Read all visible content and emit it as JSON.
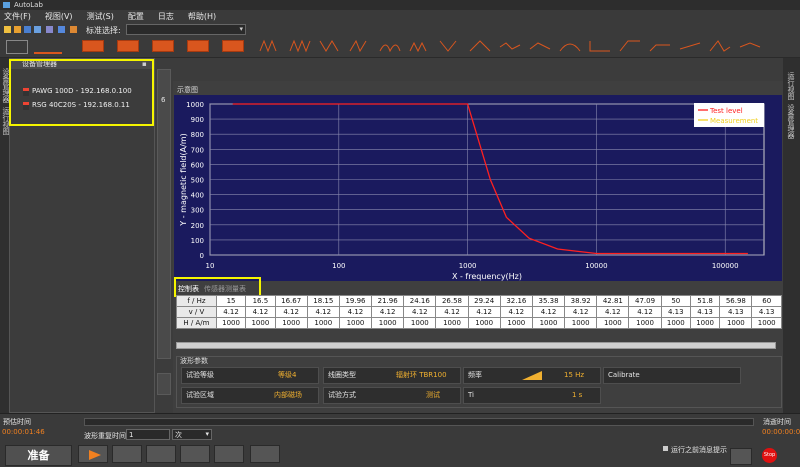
{
  "window": {
    "title": "AutoLab"
  },
  "menu": [
    "文件(F)",
    "视图(V)",
    "测试(S)",
    "配置",
    "日志",
    "帮助(H)"
  ],
  "toolbar": {
    "standard_select_label": "标准选择:",
    "standard_select_value": ""
  },
  "left_tabs": [
    "设备管理器",
    "运行视图"
  ],
  "right_tabs": [
    "运行视图",
    "设备管理器"
  ],
  "device_manager": {
    "title": "设备管理器",
    "devices": [
      "PAWG 100D - 192.168.0.100",
      "RSG 40C20S - 192.168.0.11"
    ]
  },
  "mid_tab_number": "6",
  "schematic_label": "示意图",
  "chart_data": {
    "type": "line",
    "xscale": "log",
    "xlim": [
      10,
      200000
    ],
    "ylim": [
      0,
      1000
    ],
    "xlabel": "X - frequency(Hz)",
    "ylabel": "Y - magnetic field(A/m)",
    "xticks": [
      "10",
      "100",
      "1000",
      "10000",
      "100000"
    ],
    "yticks": [
      "0",
      "100",
      "200",
      "300",
      "400",
      "500",
      "600",
      "700",
      "800",
      "900",
      "1000"
    ],
    "legend_position": "top-right",
    "series": [
      {
        "name": "Test level",
        "color": "#ff2020",
        "x": [
          15,
          1000,
          1500,
          2000,
          3000,
          5000,
          10000,
          50000,
          150000
        ],
        "y": [
          1000,
          1000,
          500,
          250,
          111,
          40,
          10,
          10,
          10
        ]
      },
      {
        "name": "Measurement",
        "color": "#f0d020",
        "x": [],
        "y": []
      }
    ]
  },
  "tabs": {
    "control": "控制表",
    "sensor": "传感器测量表"
  },
  "table": {
    "row_labels": [
      "f / Hz",
      "v / V",
      "H / A/m"
    ],
    "freq": [
      "15",
      "16.5",
      "16.67",
      "18.15",
      "19.96",
      "21.96",
      "24.16",
      "26.58",
      "29.24",
      "32.16",
      "35.38",
      "38.92",
      "42.81",
      "47.09",
      "50",
      "51.8",
      "56.98",
      "60"
    ],
    "volt": [
      "4.12",
      "4.12",
      "4.12",
      "4.12",
      "4.12",
      "4.12",
      "4.12",
      "4.12",
      "4.12",
      "4.12",
      "4.12",
      "4.12",
      "4.12",
      "4.12",
      "4.13",
      "4.13",
      "4.13",
      "4.13"
    ],
    "field": [
      "1000",
      "1000",
      "1000",
      "1000",
      "1000",
      "1000",
      "1000",
      "1000",
      "1000",
      "1000",
      "1000",
      "1000",
      "1000",
      "1000",
      "1000",
      "1000",
      "1000",
      "1000"
    ]
  },
  "wave_params": {
    "title": "波形参数",
    "test_level_label": "试验等级",
    "test_level_value": "等级4",
    "coil_type_label": "线圈类型",
    "coil_type_value": "辐射环 TBR100",
    "freq_label": "频率",
    "freq_value": "15 Hz",
    "calibrate_label": "Calibrate",
    "test_area_label": "试验区域",
    "test_area_value": "内部磁场",
    "test_method_label": "试验方式",
    "test_method_value": "测试",
    "ti_label": "Ti",
    "ti_value": "1 s"
  },
  "footer": {
    "est_time_label": "预估时间",
    "est_time_value": "00:00:01:46",
    "elapsed_label": "消逝时间",
    "elapsed_value": "00:00:00:00",
    "repeat_label": "波形重复时间",
    "repeat_value": "1",
    "repeat_unit": "次",
    "ready_button": "准备",
    "prompt_label": "运行之前消息提示",
    "stop_button": "Stop"
  },
  "colors": {
    "accent_orange": "#d9561e",
    "highlight": "#f5f500",
    "chart_bg": "#1a1a5e",
    "value_text": "#f0b030"
  }
}
